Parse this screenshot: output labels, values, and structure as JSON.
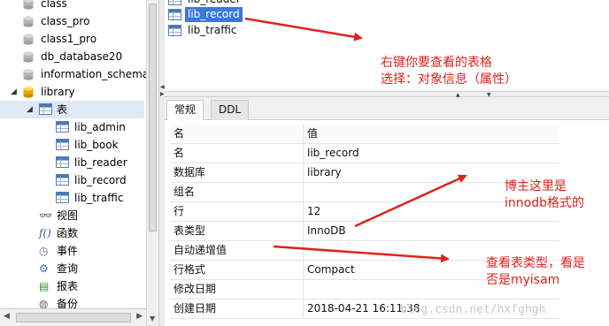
{
  "tree": {
    "databases": [
      "class",
      "class_pro",
      "class1_pro",
      "db_database20",
      "information_schema"
    ],
    "open_db": "library",
    "tables_node": "表",
    "tables": [
      "lib_admin",
      "lib_book",
      "lib_reader",
      "lib_record",
      "lib_traffic"
    ],
    "other_nodes": [
      "视图",
      "函数",
      "事件",
      "查询",
      "报表",
      "备份"
    ]
  },
  "objects": {
    "partial_top": "lib_reader",
    "selected": "lib_record",
    "next": "lib_traffic"
  },
  "tabs": [
    "常规",
    "DDL"
  ],
  "properties": {
    "header": {
      "key": "名",
      "value": "值"
    },
    "rows": [
      {
        "key": "名",
        "value": "lib_record"
      },
      {
        "key": "数据库",
        "value": "library"
      },
      {
        "key": "组名",
        "value": ""
      },
      {
        "key": "行",
        "value": "12"
      },
      {
        "key": "表类型",
        "value": "InnoDB"
      },
      {
        "key": "自动递增值",
        "value": ""
      },
      {
        "key": "行格式",
        "value": "Compact"
      },
      {
        "key": "修改日期",
        "value": ""
      },
      {
        "key": "创建日期",
        "value": "2018-04-21 16:11:38"
      }
    ]
  },
  "annotations": {
    "note1_line1": "右键你要查看的表格",
    "note1_line2": "选择：对象信息（属性）",
    "note2_line1": "博主这里是",
    "note2_line2": "innodb格式的",
    "note3_line1": "查看表类型，看是",
    "note3_line2": "否是myisam"
  },
  "watermark": "blog.csdn.net/hxfghgh",
  "colors": {
    "annotation": "#e0221c",
    "selection": "#3b78d8",
    "db_icon": "#f0b400"
  }
}
